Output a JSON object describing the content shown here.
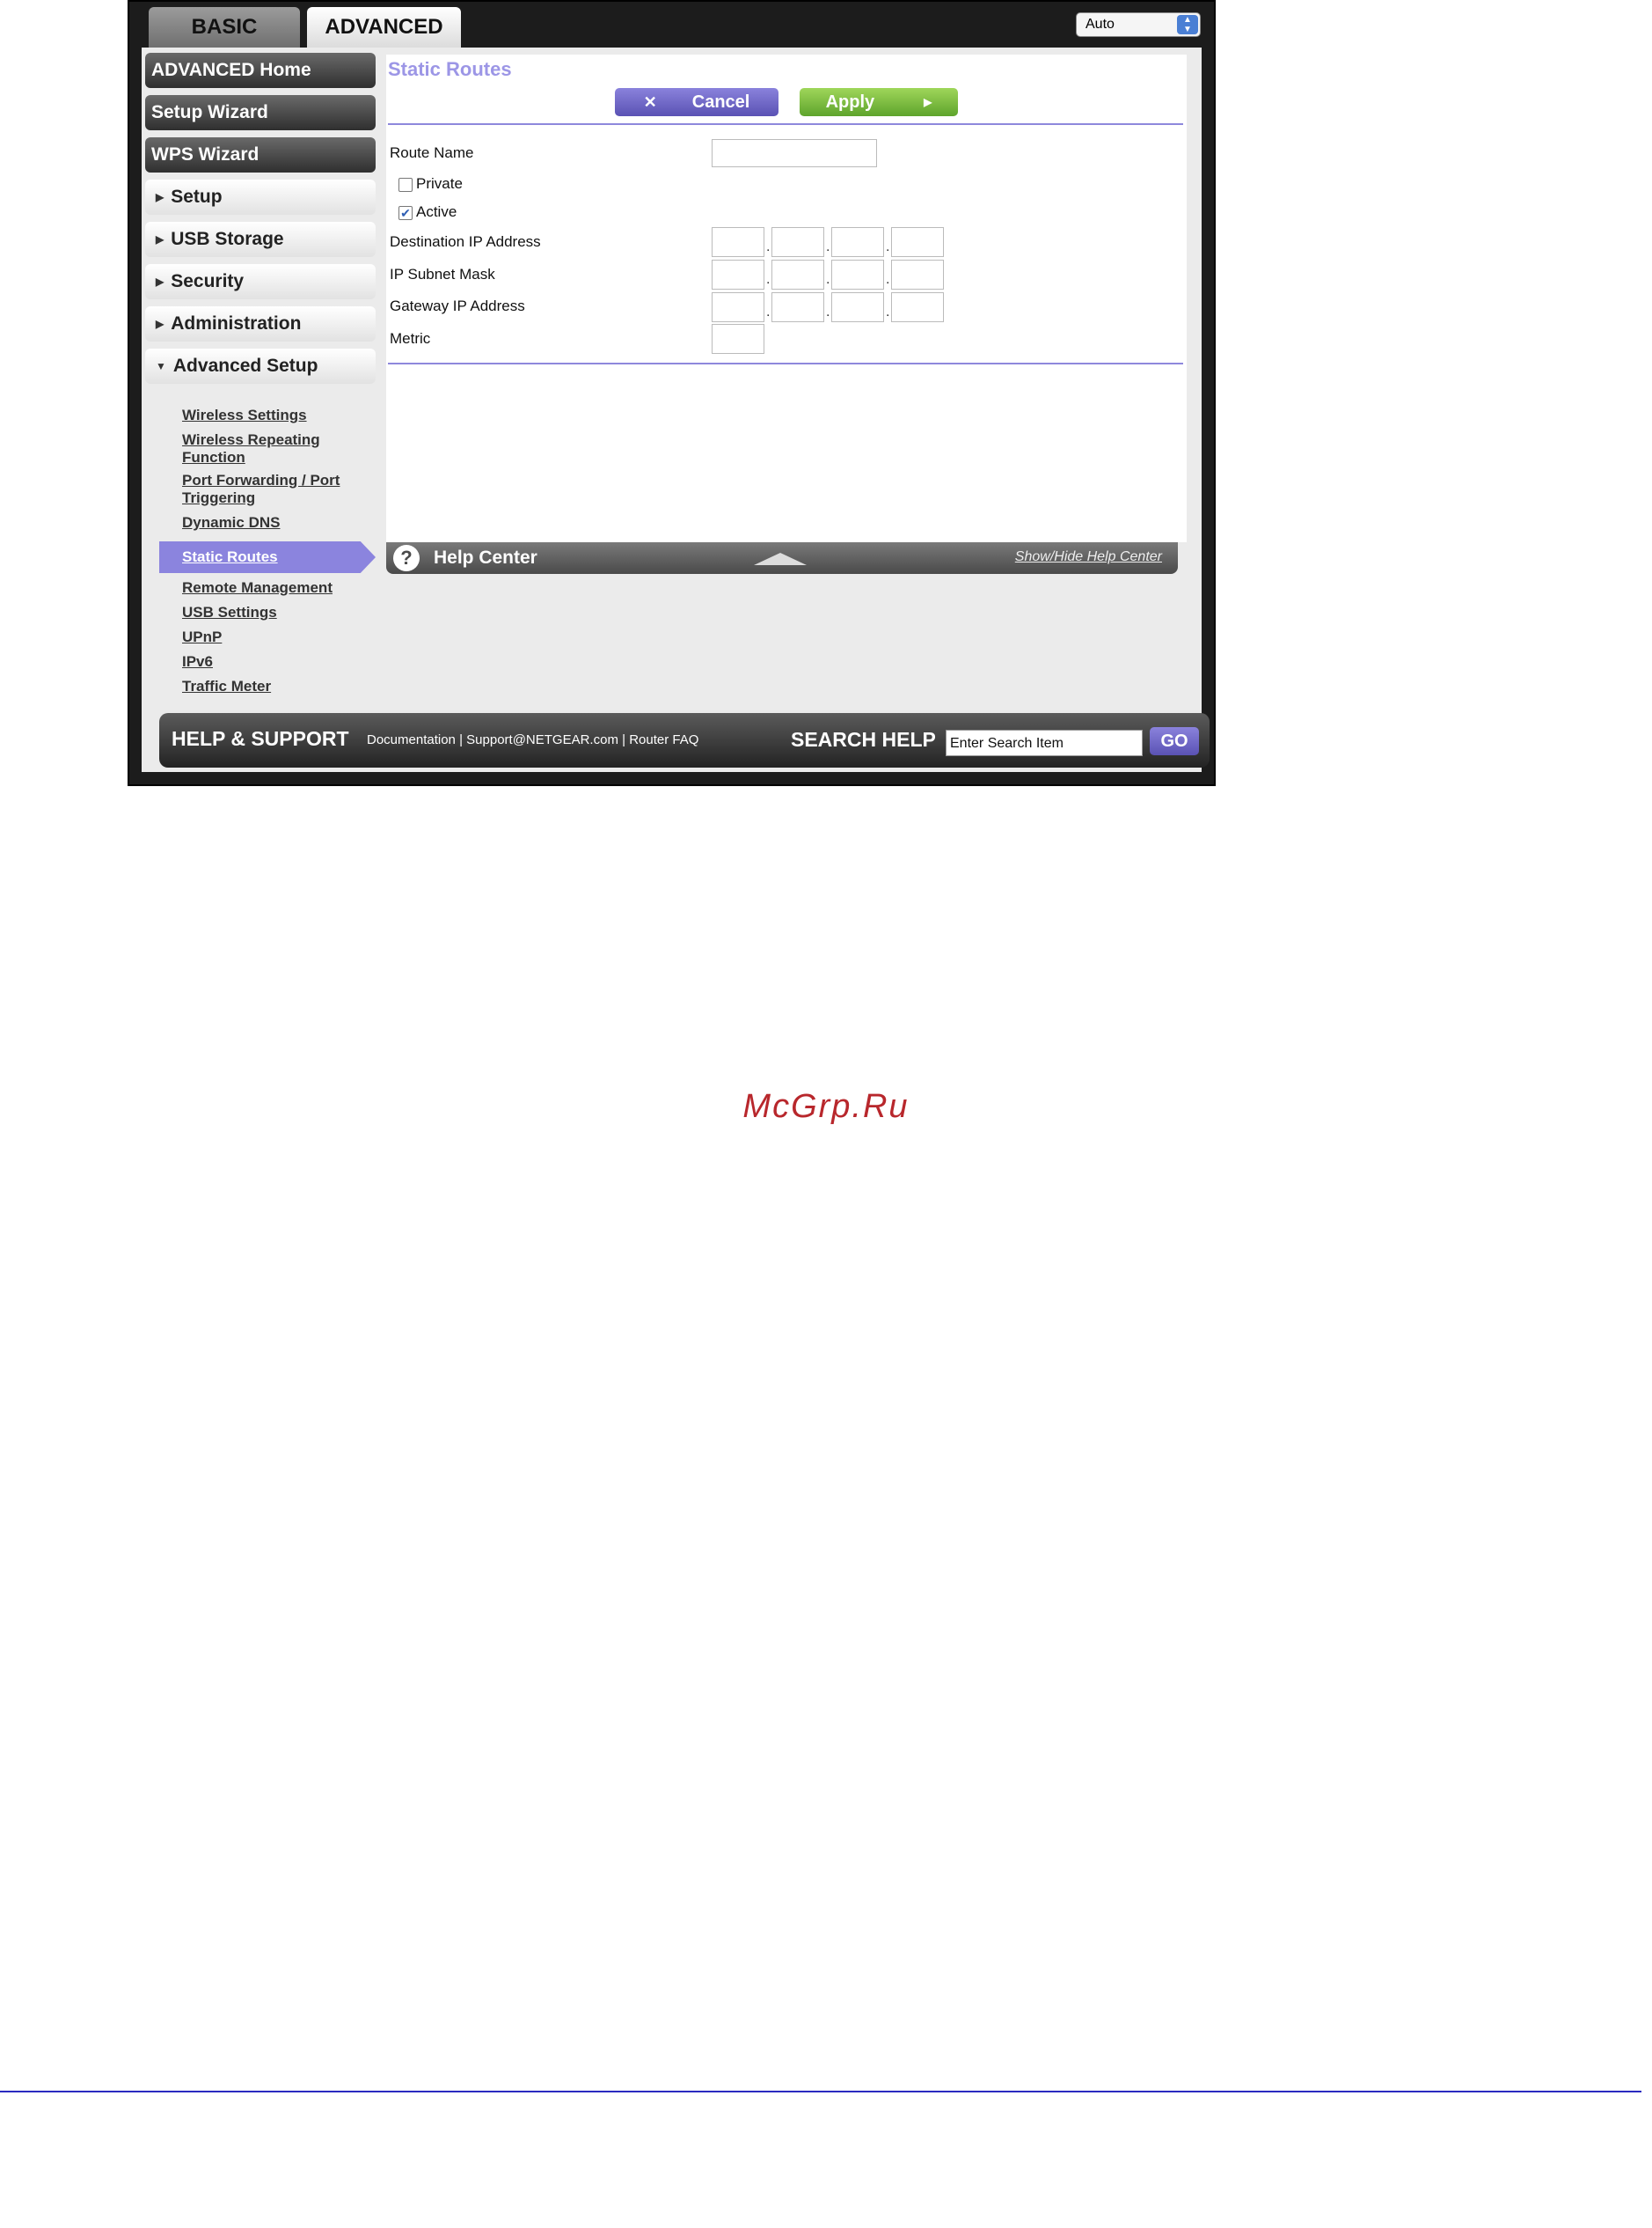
{
  "tabs": {
    "basic": "BASIC",
    "advanced": "ADVANCED"
  },
  "language_select": {
    "value": "Auto"
  },
  "sidebar": {
    "main_items": [
      "ADVANCED Home",
      "Setup Wizard",
      "WPS Wizard",
      "Setup",
      "USB Storage",
      "Security",
      "Administration",
      "Advanced Setup"
    ],
    "sub_items": [
      "Wireless Settings",
      "Wireless Repeating Function",
      "Port Forwarding / Port Triggering",
      "Dynamic DNS",
      "Static Routes",
      "Remote Management",
      "USB Settings",
      "UPnP",
      "IPv6",
      "Traffic Meter"
    ],
    "active_sub_item": "Static Routes"
  },
  "page": {
    "title": "Static Routes",
    "cancel_label": "Cancel",
    "apply_label": "Apply"
  },
  "form": {
    "route_name_label": "Route Name",
    "route_name_value": "",
    "private_label": "Private",
    "private_checked": false,
    "active_label": "Active",
    "active_checked": true,
    "destination_ip_label": "Destination IP Address",
    "subnet_mask_label": "IP Subnet Mask",
    "gateway_ip_label": "Gateway IP Address",
    "metric_label": "Metric"
  },
  "help_center": {
    "title": "Help Center",
    "toggle_link": "Show/Hide Help Center"
  },
  "footer": {
    "help_support": "HELP & SUPPORT",
    "documentation": "Documentation",
    "support_email": "Support@NETGEAR.com",
    "router_faq": "Router FAQ",
    "search_help": "SEARCH HELP",
    "search_placeholder": "Enter Search Item",
    "go_label": "GO"
  },
  "watermark": "McGrp.Ru",
  "colors": {
    "accent": "#8b84de",
    "apply": "#6db236",
    "rule": "#2a2ac0"
  }
}
